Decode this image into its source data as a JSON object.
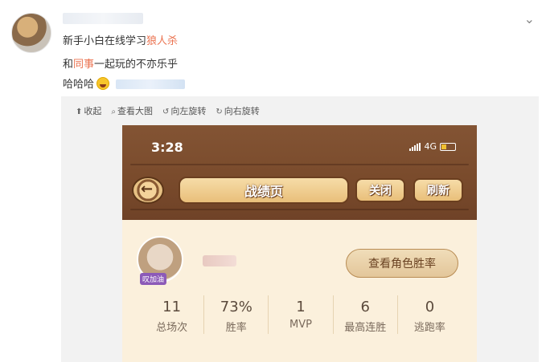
{
  "post": {
    "line1_prefix": "新手小白在线学习",
    "line1_highlight": "狼人杀",
    "line2_prefix": "和",
    "line2_highlight": "同事",
    "line2_suffix": "一起玩的不亦乐乎",
    "line3": "哈哈哈"
  },
  "toolbar": {
    "collapse": "收起",
    "view_large": "查看大图",
    "rotate_left": "向左旋转",
    "rotate_right": "向右旋转"
  },
  "game": {
    "time": "3:28",
    "network": "4G",
    "title": "战绩页",
    "close": "关闭",
    "refresh": "刷新",
    "avatar_tag": "叹加油",
    "view_role_winrate": "查看角色胜率",
    "stats": [
      {
        "value": "11",
        "label": "总场次"
      },
      {
        "value": "73%",
        "label": "胜率"
      },
      {
        "value": "1",
        "label": "MVP"
      },
      {
        "value": "6",
        "label": "最高连胜"
      },
      {
        "value": "0",
        "label": "逃跑率"
      }
    ]
  },
  "colors": {
    "accent": "#eb7350",
    "wood": "#7a4b2c",
    "panel": "#fbf0dc"
  },
  "icons": [
    "chevron-down-icon",
    "collapse-icon",
    "zoom-icon",
    "rotate-left-icon",
    "rotate-right-icon",
    "back-arrow-icon",
    "signal-icon",
    "battery-icon",
    "laugh-emoji-icon"
  ]
}
